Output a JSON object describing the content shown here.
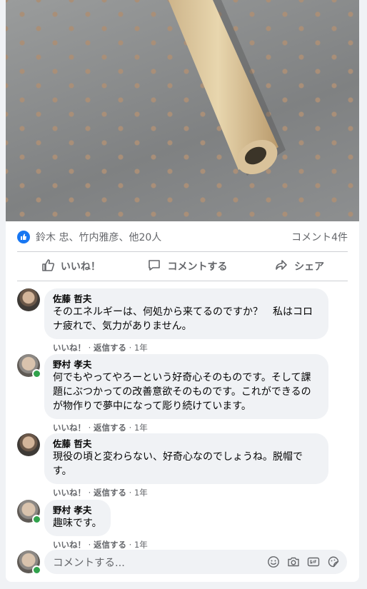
{
  "post": {
    "reactions_text": "鈴木 忠、竹内雅彦、他20人",
    "comments_count": "コメント4件",
    "actions": {
      "like": "いいね！",
      "comment": "コメントする",
      "share": "シェア"
    }
  },
  "comments": [
    {
      "author": "佐藤 哲夫",
      "text": "そのエネルギーは、何処から来てるのですか？　私はコロナ疲れで、気力がありません。",
      "like": "いいね！",
      "reply": "返信する",
      "time": "1年"
    },
    {
      "author": "野村 孝夫",
      "text": "何でもやってやろーという好奇心そのものです。そして課題にぶつかっての改善意欲そのものです。これができるのが物作りで夢中になって彫り続けています。",
      "like": "いいね！",
      "reply": "返信する",
      "time": "1年"
    },
    {
      "author": "佐藤 哲夫",
      "text": "現役の頃と変わらない、好奇心なのでしょうね。脱帽です。",
      "like": "いいね！",
      "reply": "返信する",
      "time": "1年"
    },
    {
      "author": "野村 孝夫",
      "text": "趣味です。",
      "like": "いいね！",
      "reply": "返信する",
      "time": "1年"
    }
  ],
  "composer": {
    "placeholder": "コメントする..."
  },
  "icons": {
    "reaction": "like-icon",
    "like": "thumbs-up-icon",
    "comment": "speech-bubble-icon",
    "share": "share-arrow-icon",
    "composer": [
      "emoji-icon",
      "camera-icon",
      "gif-icon",
      "sticker-icon"
    ]
  },
  "colors": {
    "brand": "#1877f2",
    "online": "#31a24c",
    "muted": "#65676b"
  }
}
